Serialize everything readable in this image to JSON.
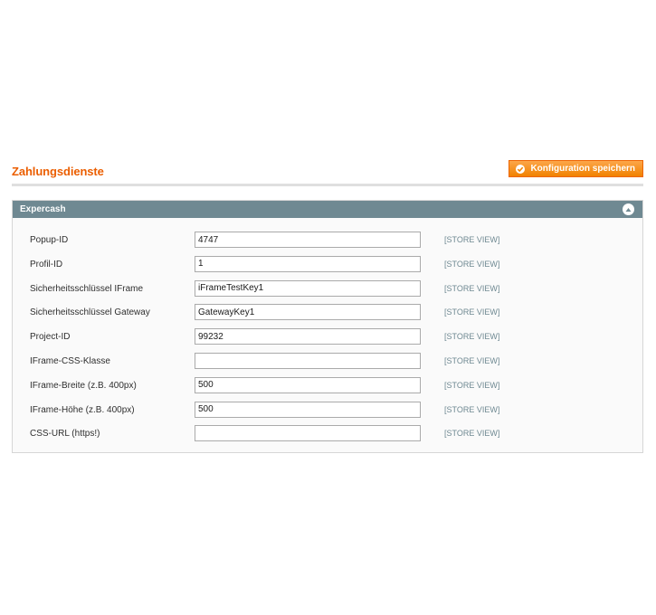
{
  "header": {
    "title": "Zahlungsdienste",
    "save_label": "Konfiguration speichern"
  },
  "section": {
    "title": "Expercash",
    "collapse_icon": "arrow-up-icon"
  },
  "fields": [
    {
      "label": "Popup-ID",
      "value": "4747",
      "scope": "[STORE VIEW]"
    },
    {
      "label": "Profil-ID",
      "value": "1",
      "scope": "[STORE VIEW]"
    },
    {
      "label": "Sicherheitsschlüssel IFrame",
      "value": "iFrameTestKey1",
      "scope": "[STORE VIEW]"
    },
    {
      "label": "Sicherheitsschlüssel Gateway",
      "value": "GatewayKey1",
      "scope": "[STORE VIEW]"
    },
    {
      "label": "Project-ID",
      "value": "99232",
      "scope": "[STORE VIEW]"
    },
    {
      "label": "IFrame-CSS-Klasse",
      "value": "",
      "scope": "[STORE VIEW]"
    },
    {
      "label": "IFrame-Breite (z.B. 400px)",
      "value": "500",
      "scope": "[STORE VIEW]"
    },
    {
      "label": "IFrame-Höhe (z.B. 400px)",
      "value": "500",
      "scope": "[STORE VIEW]"
    },
    {
      "label": "CSS-URL (https!)",
      "value": "",
      "scope": "[STORE VIEW]"
    }
  ],
  "colors": {
    "accent": "#eb5e00",
    "button": "#f18200",
    "section_header": "#6f8992"
  }
}
